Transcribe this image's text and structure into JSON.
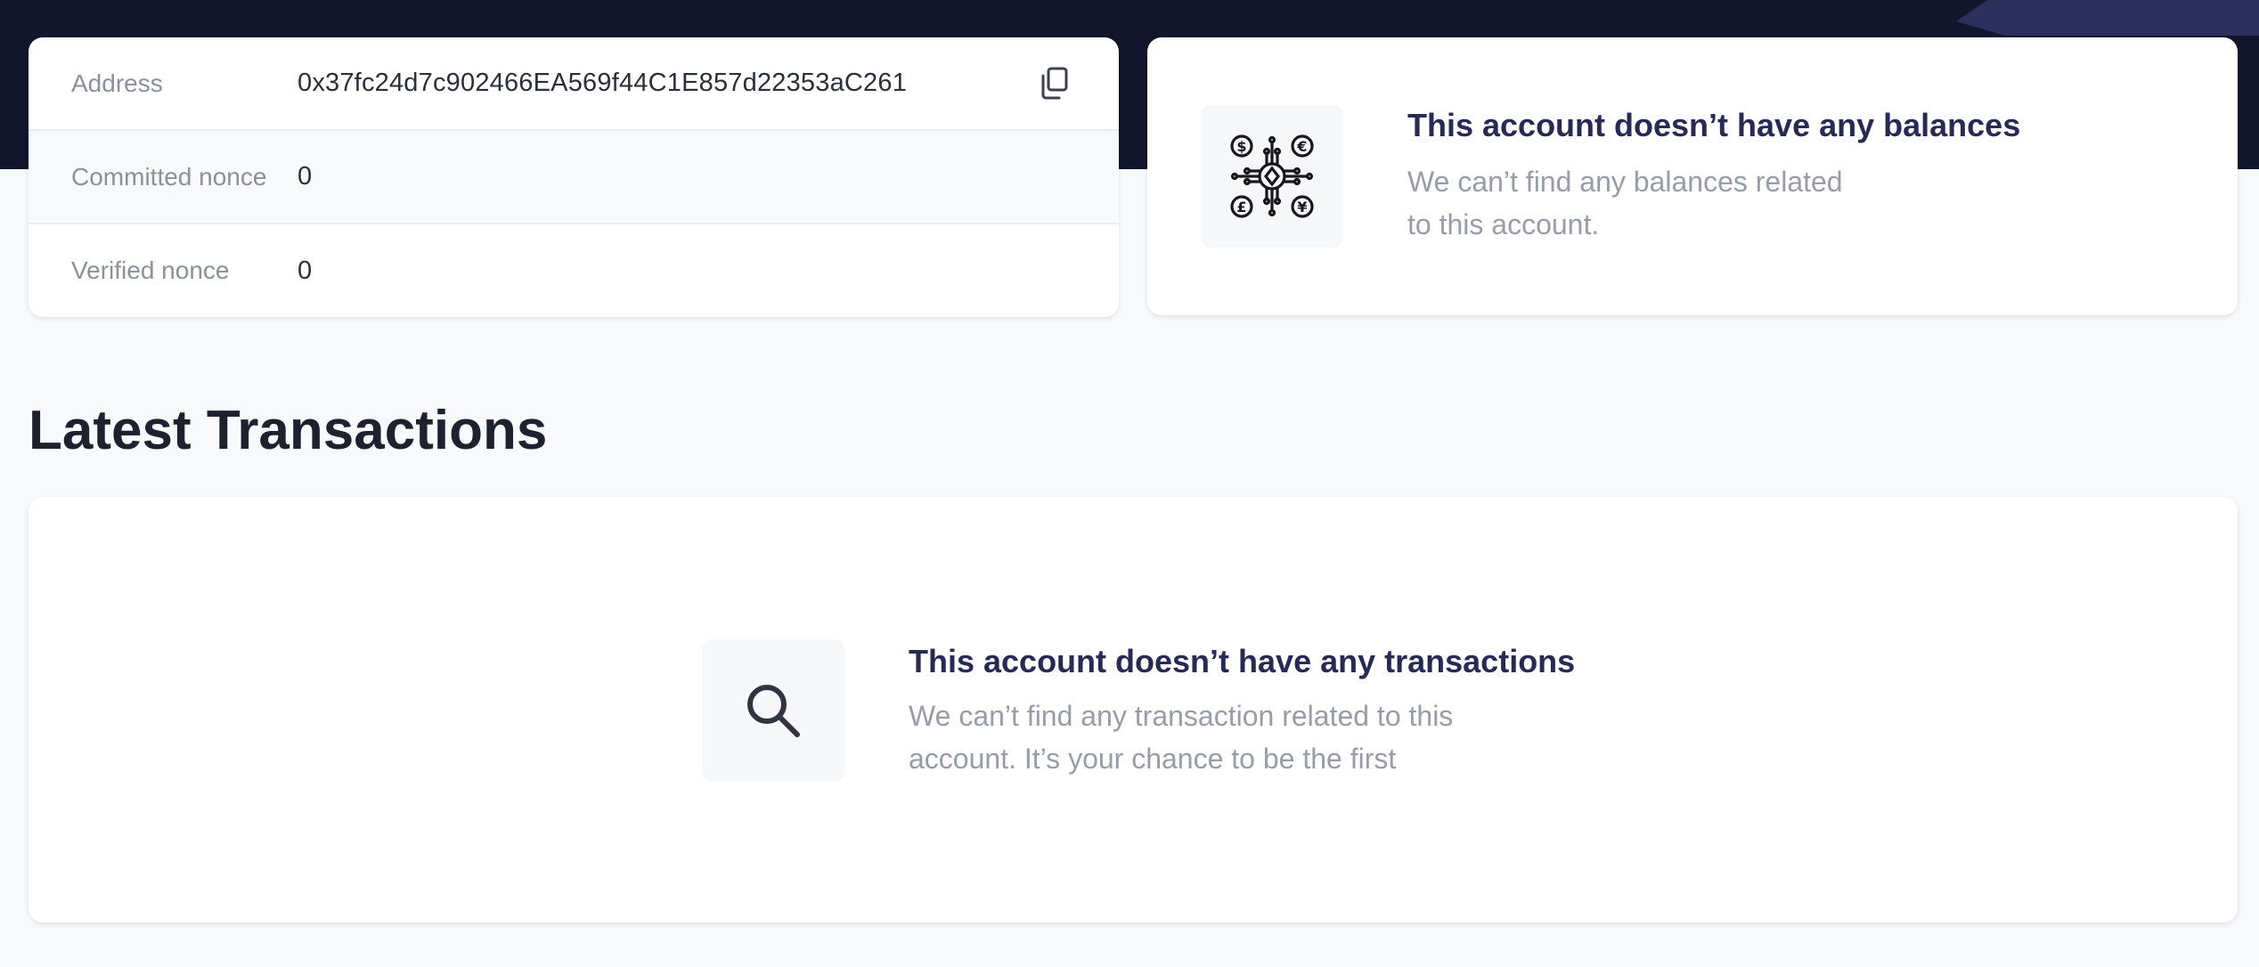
{
  "account": {
    "rows": [
      {
        "label": "Address",
        "value": "0x37fc24d7c902466EA569f44C1E857d22353aC261"
      },
      {
        "label": "Committed nonce",
        "value": "0"
      },
      {
        "label": "Verified nonce",
        "value": "0"
      }
    ],
    "copy_icon": "copy-icon"
  },
  "balances": {
    "icon": "currency-network-icon",
    "title": "This account doesn’t have any balances",
    "description": "We can’t find any balances related to this account."
  },
  "transactions": {
    "section_title": "Latest Transactions",
    "icon": "search-icon",
    "title": "This account doesn’t have any transactions",
    "description": "We can’t find any transaction related to this account. It’s your chance to be the first"
  },
  "colors": {
    "header_band": "#13152d",
    "accent": "#2d2f5c",
    "page_background": "#f8f9fb",
    "title_text": "#272a54",
    "muted_text": "#979ca8"
  }
}
